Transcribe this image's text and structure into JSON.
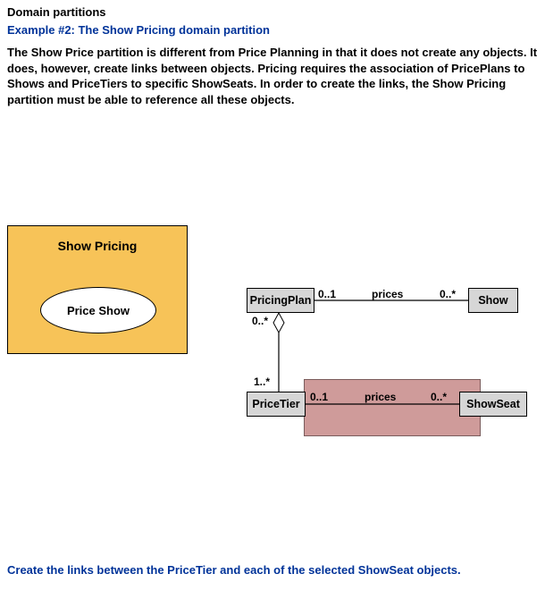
{
  "header": {
    "title": "Domain partitions",
    "subtitle": "Example #2:  The Show Pricing domain partition"
  },
  "description": "The Show Price partition is different from Price Planning in that it does not create any objects.  It does, however, create links between objects.  Pricing requires the association of PricePlans to Shows and PriceTiers to specific ShowSeats.  In order to create the links, the Show Pricing partition must be able to reference all these objects.",
  "partition": {
    "label": "Show Pricing",
    "usecase": "Price Show"
  },
  "classes": {
    "pricing_plan": "PricingPlan",
    "show": "Show",
    "price_tier": "PriceTier",
    "show_seat": "ShowSeat"
  },
  "associations": {
    "plan_to_show": {
      "left_mult": "0..1",
      "role": "prices",
      "right_mult": "0..*"
    },
    "plan_to_tier": {
      "top_mult": "0..*",
      "bottom_mult": "1..*",
      "kind": "aggregation"
    },
    "tier_to_seat": {
      "left_mult": "0..1",
      "role": "prices",
      "right_mult": "0..*"
    }
  },
  "footer_note": "Create the links between the PriceTier and each of the selected ShowSeat objects.",
  "chart_data": {
    "type": "uml-class-diagram",
    "partition": {
      "name": "Show Pricing",
      "use_cases": [
        "Price Show"
      ]
    },
    "classes": [
      "PricingPlan",
      "Show",
      "PriceTier",
      "ShowSeat"
    ],
    "highlighted_association": "PriceTier–ShowSeat",
    "associations": [
      {
        "from": "PricingPlan",
        "to": "Show",
        "from_multiplicity": "0..1",
        "to_multiplicity": "0..*",
        "role": "prices",
        "type": "association"
      },
      {
        "from": "PricingPlan",
        "to": "PriceTier",
        "from_multiplicity": "0..*",
        "to_multiplicity": "1..*",
        "type": "aggregation",
        "diamond_at": "PricingPlan"
      },
      {
        "from": "PriceTier",
        "to": "ShowSeat",
        "from_multiplicity": "0..1",
        "to_multiplicity": "0..*",
        "role": "prices",
        "type": "association"
      }
    ]
  }
}
